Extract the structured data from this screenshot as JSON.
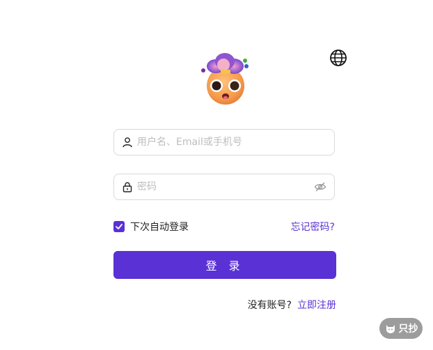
{
  "login_form": {
    "username": {
      "placeholder": "用户名、Email或手机号",
      "value": "",
      "icon": "user-icon"
    },
    "password": {
      "placeholder": "密码",
      "value": "",
      "icon": "lock-icon",
      "toggle_icon": "eye-off-icon"
    },
    "remember_me": {
      "label": "下次自动登录",
      "checked": true
    },
    "forgot_password": "忘记密码?",
    "submit_label": "登 录"
  },
  "register": {
    "prompt": "没有账号?",
    "link": "立即注册"
  },
  "header": {
    "language_icon": "globe-icon",
    "logo": "emoji-avatar"
  },
  "badge": {
    "label": "只抄",
    "icon": "cat-icon"
  },
  "colors": {
    "accent": "#5a31d4",
    "border": "#d9d9d9",
    "placeholder": "#bdbdbd",
    "badge_bg": "#9c9c9c"
  }
}
